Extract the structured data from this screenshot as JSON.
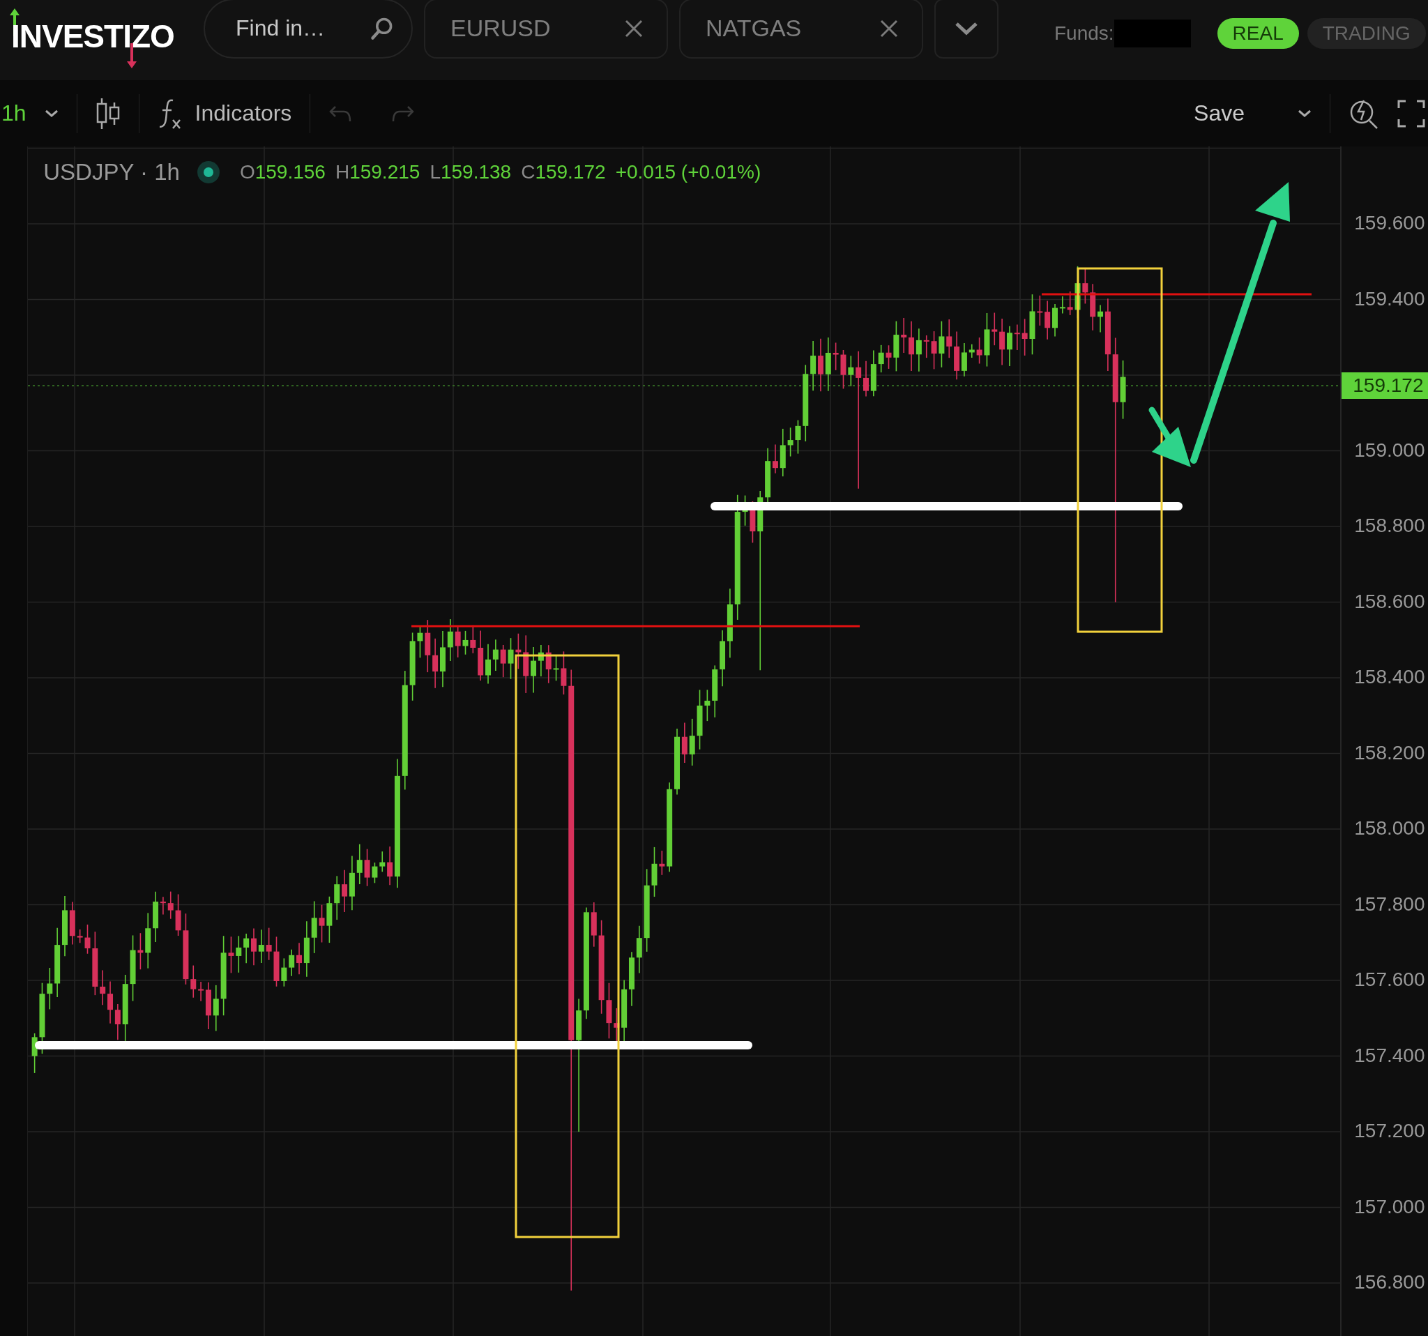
{
  "header": {
    "logo": "INVESTIZO",
    "search": {
      "placeholder": "Find in…"
    },
    "tabs": [
      {
        "label": "EURUSD"
      },
      {
        "label": "NATGAS"
      }
    ],
    "funds": {
      "label": "Funds:"
    },
    "modes": [
      {
        "label": "REAL",
        "selected": true
      },
      {
        "label": "TRADING",
        "selected": false
      }
    ]
  },
  "toolbar": {
    "interval": "1h",
    "indicators": "Indicators",
    "undo": {
      "disabled": true
    },
    "redo": {
      "disabled": true
    },
    "save": "Save"
  },
  "legend": {
    "symbol": "USDJPY · 1h",
    "values": [
      {
        "label": "O",
        "value": "159.156"
      },
      {
        "label": "H",
        "value": "159.215"
      },
      {
        "label": "L",
        "value": "159.138"
      },
      {
        "label": "C",
        "value": "159.172"
      }
    ],
    "change": "+0.015 (+0.01%)"
  },
  "price_axis": {
    "labels": [
      "159.600",
      "159.400",
      "159.000",
      "158.800",
      "158.600",
      "158.400",
      "158.200",
      "158.000",
      "157.800",
      "157.600",
      "157.400",
      "157.200",
      "157.000",
      "156.800"
    ],
    "current_price": "159.172"
  }
}
